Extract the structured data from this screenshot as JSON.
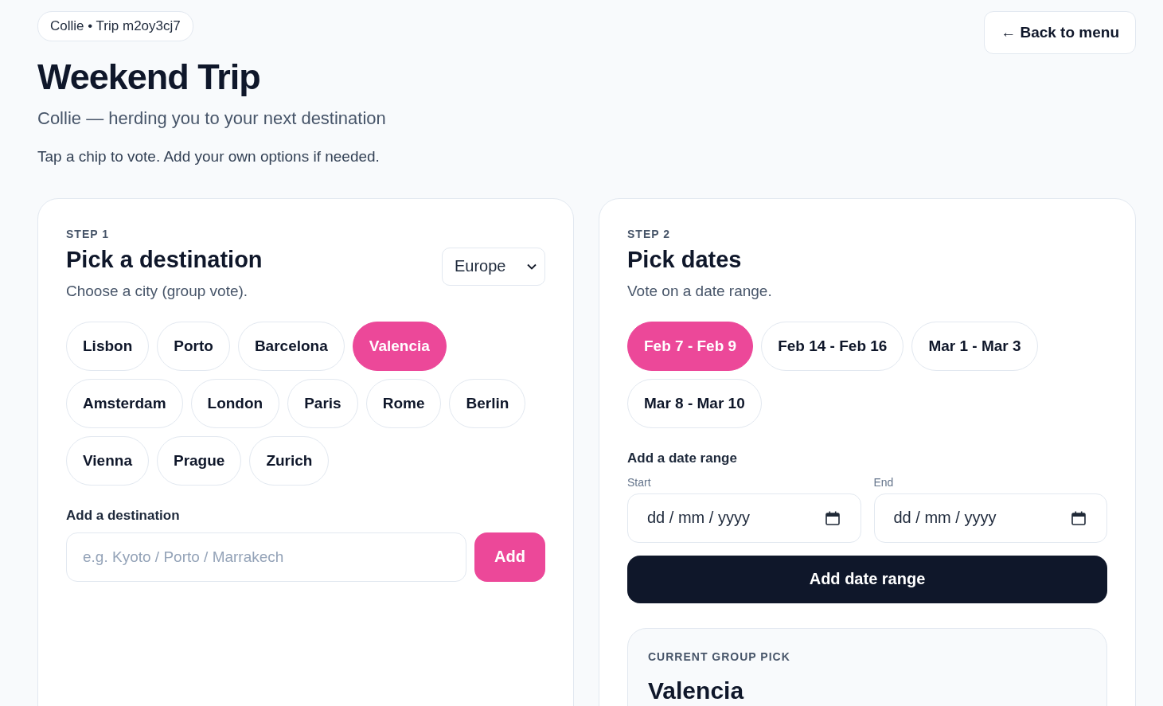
{
  "badge": "Collie • Trip m2oy3cj7",
  "back_button": "← Back to menu",
  "title": "Weekend Trip",
  "subtitle": "Collie — herding you to your next destination",
  "instruction": "Tap a chip to vote. Add your own options if needed.",
  "destination_card": {
    "step": "STEP 1",
    "heading": "Pick a destination",
    "description": "Choose a city (group vote).",
    "region_select": "Europe",
    "chips": [
      {
        "label": "Lisbon",
        "selected": false
      },
      {
        "label": "Porto",
        "selected": false
      },
      {
        "label": "Barcelona",
        "selected": false
      },
      {
        "label": "Valencia",
        "selected": true
      },
      {
        "label": "Amsterdam",
        "selected": false
      },
      {
        "label": "London",
        "selected": false
      },
      {
        "label": "Paris",
        "selected": false
      },
      {
        "label": "Rome",
        "selected": false
      },
      {
        "label": "Berlin",
        "selected": false
      },
      {
        "label": "Vienna",
        "selected": false
      },
      {
        "label": "Prague",
        "selected": false
      },
      {
        "label": "Zurich",
        "selected": false
      }
    ],
    "add_label": "Add a destination",
    "add_field": {
      "placeholder": "e.g. Kyoto / Porto / Marrakech"
    },
    "add_button": "Add"
  },
  "dates_card": {
    "step": "STEP 2",
    "heading": "Pick dates",
    "description": "Vote on a date range.",
    "chips": [
      {
        "label": "Feb 7 - Feb 9",
        "selected": true
      },
      {
        "label": "Feb 14 - Feb 16",
        "selected": false
      },
      {
        "label": "Mar 1 - Mar 3",
        "selected": false
      },
      {
        "label": "Mar 8 - Mar 10",
        "selected": false
      }
    ],
    "add_label": "Add a date range",
    "start": {
      "label": "Start",
      "placeholder": "dd / mm / yyyy"
    },
    "end": {
      "label": "End",
      "placeholder": "dd / mm / yyyy"
    },
    "add_button": "Add date range",
    "group_pick": {
      "label": "CURRENT GROUP PICK",
      "value": "Valencia"
    }
  }
}
